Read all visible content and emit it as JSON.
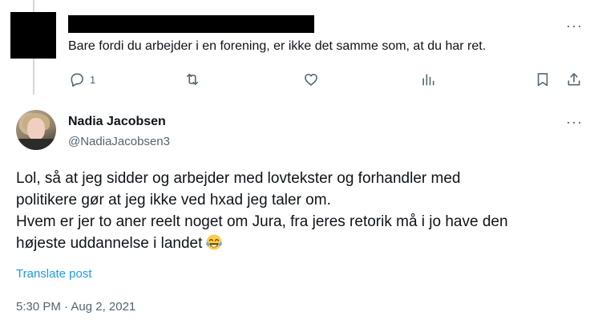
{
  "reply": {
    "text": "Bare fordi du arbejder i en forening, er ikke det samme som, at du har ret.",
    "more_label": "···",
    "actions": {
      "reply_count": "1",
      "retweet_count": "",
      "like_count": "",
      "views_count": ""
    }
  },
  "tweet": {
    "author_name": "Nadia Jacobsen",
    "author_handle": "@NadiaJacobsen3",
    "more_label": "···",
    "lines": [
      "Lol, så at jeg sidder og arbejder med lovtekster og forhandler med",
      "politikere gør at jeg ikke ved hxad jeg taler om.",
      "Hvem er jer to aner reelt noget om Jura, fra jeres retorik må i jo have den",
      "højeste uddannelse i landet"
    ],
    "emoji": "face-with-tears-of-joy",
    "translate_label": "Translate post",
    "timestamp": "5:30 PM · Aug 2, 2021"
  },
  "colors": {
    "text": "#0f1419",
    "muted": "#536471",
    "link": "#1d9bf0",
    "thread_line": "#cfd9de"
  }
}
